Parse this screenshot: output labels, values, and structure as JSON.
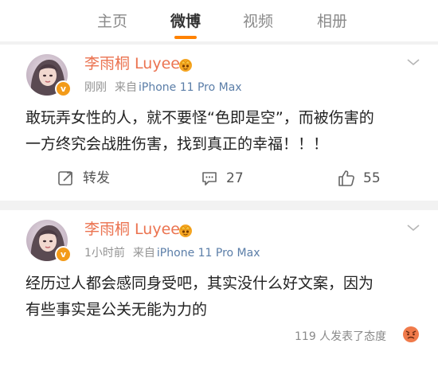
{
  "tabs": [
    {
      "label": "主页"
    },
    {
      "label": "微博"
    },
    {
      "label": "视频"
    },
    {
      "label": "相册"
    }
  ],
  "active_tab_index": 1,
  "accent_color": "#ff8200",
  "username_color": "#eb7350",
  "posts": [
    {
      "username": "李雨桐 Luyee",
      "verified_badge": "v",
      "time": "刚刚",
      "from_label": "来自",
      "device": "iPhone 11 Pro Max",
      "content_line1": "敢玩弄女性的人，就不要怪“色即是空”，而被伤害的",
      "content_line2": "一方终究会战胜伤害，找到真正的幸福！！！",
      "repost_label": "转发",
      "comment_count": "27",
      "like_count": "55"
    },
    {
      "username": "李雨桐 Luyee",
      "verified_badge": "v",
      "time": "1小时前",
      "from_label": "来自",
      "device": "iPhone 11 Pro Max",
      "content_line1": "经历过人都会感同身受吧，其实没什么好文案，因为",
      "content_line2": "有些事实是公关无能为力的",
      "reactions_text": "119 人发表了态度"
    }
  ]
}
